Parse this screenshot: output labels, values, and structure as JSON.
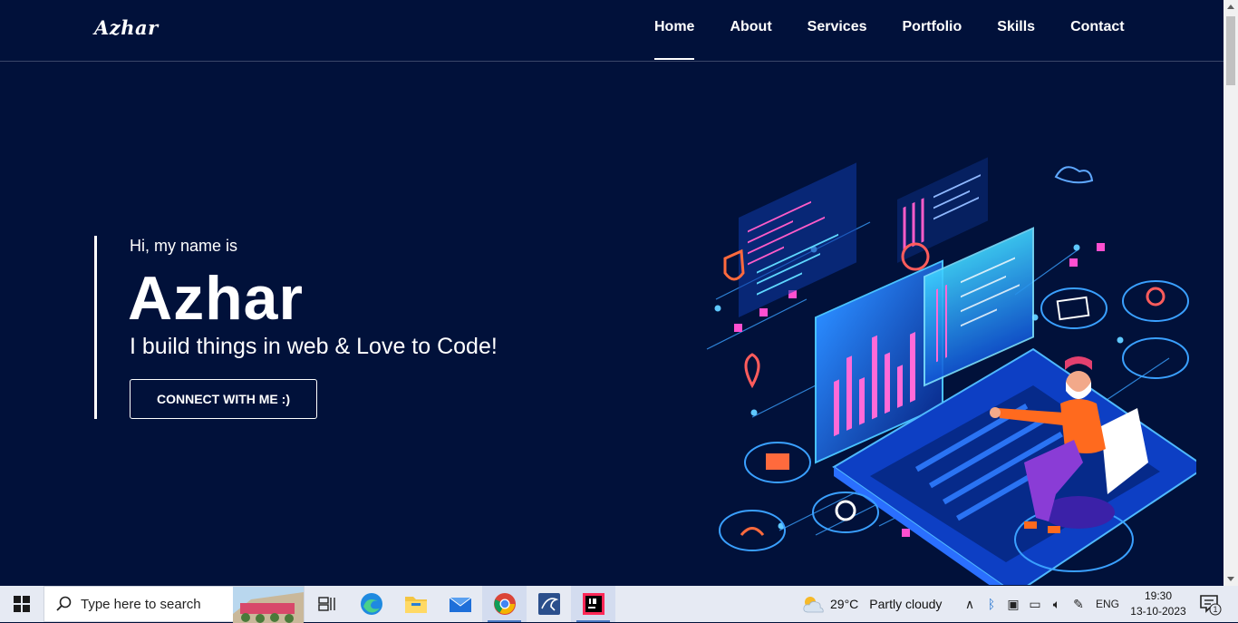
{
  "site": {
    "logo": "Azhar",
    "nav": [
      "Home",
      "About",
      "Services",
      "Portfolio",
      "Skills",
      "Contact"
    ],
    "active_nav": "Home"
  },
  "hero": {
    "greeting": "Hi, my name is",
    "name": "Azhar",
    "tagline": "I build things in web & Love to Code!",
    "cta_label": "CONNECT WITH ME :)"
  },
  "taskbar": {
    "search_placeholder": "Type here to search",
    "pinned": [
      "task-view-icon",
      "edge-icon",
      "file-explorer-icon",
      "mail-icon",
      "chrome-icon",
      "mysql-workbench-icon",
      "intellij-icon"
    ],
    "weather_temp": "29°C",
    "weather_desc": "Partly cloudy",
    "language": "ENG",
    "time": "19:30",
    "date": "13-10-2023",
    "notification_count": "1"
  },
  "colors": {
    "background": "#01113a",
    "text": "#ffffff",
    "taskbar": "#e6eaf3"
  }
}
